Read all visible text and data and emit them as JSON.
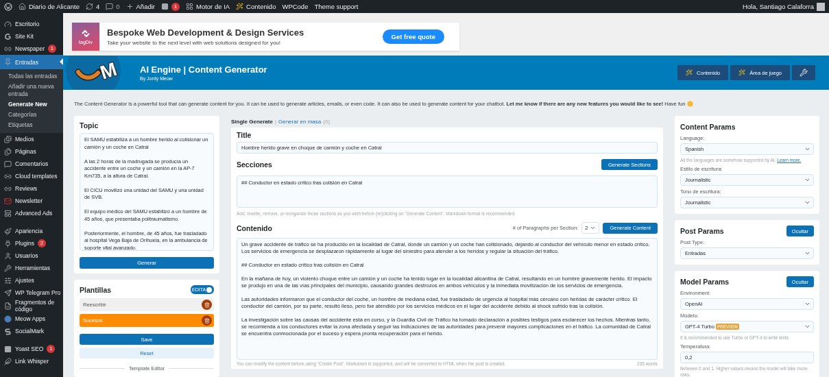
{
  "admin_bar": {
    "site": "Diario de Alicante",
    "updates": "4",
    "comments": "0",
    "new": "Añadir",
    "yoast_badge": "1",
    "links": [
      "Motor de IA",
      "Contenido",
      "WPCode",
      "Theme support"
    ],
    "greeting": "Hola, Santiago Calaforra"
  },
  "sidebar": {
    "groups": [
      [
        {
          "label": "Escritorio",
          "selected": false
        },
        {
          "label": "Site Kit",
          "selected": false
        },
        {
          "label": "Newspaper",
          "badge": "1",
          "selected": false
        },
        {
          "label": "Entradas",
          "selected": true,
          "children": [
            {
              "label": "Todas las entradas",
              "selected": false
            },
            {
              "label": "Añadir una nueva entrada",
              "selected": false
            },
            {
              "label": "Generate New",
              "selected": true
            },
            {
              "label": "Categorías",
              "selected": false
            },
            {
              "label": "Etiquetas",
              "selected": false
            }
          ]
        },
        {
          "label": "Medios",
          "selected": false
        },
        {
          "label": "Páginas",
          "selected": false
        },
        {
          "label": "Comentarios",
          "selected": false
        },
        {
          "label": "Cloud templates",
          "selected": false
        },
        {
          "label": "Reviews",
          "selected": false
        },
        {
          "label": "Newsletter",
          "selected": false
        },
        {
          "label": "Advanced Ads",
          "selected": false
        }
      ],
      [
        {
          "label": "Apariencia",
          "selected": false
        },
        {
          "label": "Plugins",
          "badge": "2",
          "selected": false
        },
        {
          "label": "Usuarios",
          "selected": false
        },
        {
          "label": "Herramientas",
          "selected": false
        },
        {
          "label": "Ajustes",
          "selected": false
        },
        {
          "label": "WP Telegram Pro",
          "selected": false
        },
        {
          "label": "Fragmentos de código",
          "selected": false
        },
        {
          "label": "Meow Apps",
          "selected": false
        },
        {
          "label": "SocialMark",
          "selected": false
        }
      ],
      [
        {
          "label": "Yoast SEO",
          "badge": "1",
          "selected": false
        },
        {
          "label": "Link Whisper",
          "selected": false
        }
      ]
    ]
  },
  "banner": {
    "brand": "tagDiv",
    "title": "Bespoke Web Development & Design Services",
    "subtitle": "Take your website to the next level with web solutions designed for you!",
    "button": "Get free quote"
  },
  "header": {
    "logo_letter": "M",
    "title": "AI Engine | Content Generator",
    "byline": "By Jordy Meow",
    "buttons": [
      "Contenido",
      "Área de juego"
    ]
  },
  "intro": "The Content Generator is a powerful tool that can generate content for you. It can be used to generate articles, emails, or even code. It can also be used to generate content for your chatbot. **Let me know if there are any new features you would like to see!** Have fun",
  "topic": {
    "title": "Topic",
    "value": "El SAMU estabiliza a un hombre herido al colisionar un camión y un coche en Catral\n\nA las 2 horas de la madrugada se producía un accidente entre un coche y un camión en la AP-7 Km735, a la altura de Catral.\n\nEl CICU movilizó una unidad del SAMU y una unidad de SVB.\n\nEl equipo médico del SAMU estabilizó a un hombre de 45 años, que presentaba politraumatismo.\n\nPosteriormente, el hombre, de 45 años, fue trasladado al hospital Vega Baja de Orihuela, en la ambulancia de soporte vital avanzado.",
    "button": "Generar"
  },
  "templates": {
    "title": "Plantillas",
    "edit_toggle": {
      "label": "EDITA",
      "on": true
    },
    "items": [
      {
        "label": "Reescribir",
        "selected": false
      },
      {
        "label": "Sucesos",
        "selected": true
      }
    ],
    "save": "Save",
    "reset": "Reset",
    "editor_label": "Template Editor"
  },
  "mode_separator": "|",
  "modes": [
    {
      "label": "Single Generate",
      "selected": true
    },
    {
      "label": "Generar en masa",
      "count": "(0)",
      "selected": false
    }
  ],
  "generator": {
    "title_label": "Title",
    "title_value": "Hombre herido grave en choque de camión y coche en Catral",
    "sections_label": "Secciones",
    "sections_button": "Generate Sections",
    "sections_value": "## Conductor en estado crítico tras colisión en Catral",
    "sections_hint": "Add, rewrite, remove, or reorganize those sections as you wish before (re)clicking on \"Generate Content\". Markdown format is recommended.",
    "content_label": "Contenido",
    "paragraphs_label": "# of Paragraphs per Section:",
    "paragraphs_value": "2",
    "content_button": "Generate Content",
    "content_value": "Un grave accidente de tráfico se ha producido en la localidad de Catral, donde un camión y un coche han colisionado, dejando al conductor del vehículo menor en estado crítico. Los servicios de emergencia se desplazaron rápidamente al lugar del siniestro para atender a los heridos y regular la situación del tráfico.\n\n## Conductor en estado crítico tras colisión en Catral\n\nEn la mañana de hoy, un violento choque entre un camión y un coche ha tenido lugar en la localidad alicantina de Catral, resultando en un hombre gravemente herido. El impacto se produjo en una de las vías principales del municipio, causando grandes destrozos en ambos vehículos y la inmediata movilización de los servicios de emergencia.\n\nLas autoridades informaron que el conductor del coche, un hombre de mediana edad, fue trasladado de urgencia al hospital más cercano con heridas de carácter crítico. El conductor del camión, por su parte, resultó ileso, pero fue atendido por los servicios médicos en el lugar del accidente debido al shock sufrido tras la colisión.\n\nLa investigación sobre las causas del accidente está en curso, y la Guardia Civil de Tráfico ha tomado declaración a posibles testigos para esclarecer los hechos. Mientras tanto, se recomienda a los conductores evitar la zona afectada y seguir las indicaciones de las autoridades para prevenir mayores complicaciones en el tráfico. La comunidad de Catral se encuentra conmocionada por el suceso y espera pronta recuperación para el herido.",
    "content_hint": "You can modify the content before using \"Create Post\". Markdown is supported, and will be converted to HTML when the post is created.",
    "word_count": "235 words"
  },
  "panels": [
    {
      "title": "Content Params",
      "fields": [
        {
          "kind": "select",
          "label": "Language:",
          "value": "Spanish",
          "hint": "All the languages are somehow supported by AI.",
          "hint_link": "Learn more."
        },
        {
          "kind": "select",
          "label": "Estilo de escritura:",
          "value": "Journalistic"
        },
        {
          "kind": "select",
          "label": "Tono de escritura:",
          "value": "Journalistic"
        }
      ]
    },
    {
      "title": "Post Params",
      "button": "Ocultar",
      "fields": [
        {
          "kind": "select",
          "label": "Post Type:",
          "value": "Entradas"
        }
      ]
    },
    {
      "title": "Model Params",
      "button": "Ocultar",
      "fields": [
        {
          "kind": "select",
          "label": "Environment:",
          "value": "OpenAI"
        },
        {
          "kind": "select",
          "label": "Modelo:",
          "value": "GPT-4 Turbo",
          "badge": "PREVIEW",
          "hint": "It is recommended to use Turbo or GPT-4 to write texts."
        },
        {
          "kind": "input",
          "label": "Temperatura:",
          "value": "0,2",
          "hint": "Between 0 and 1. Higher values means the model will take more risks."
        }
      ]
    }
  ]
}
